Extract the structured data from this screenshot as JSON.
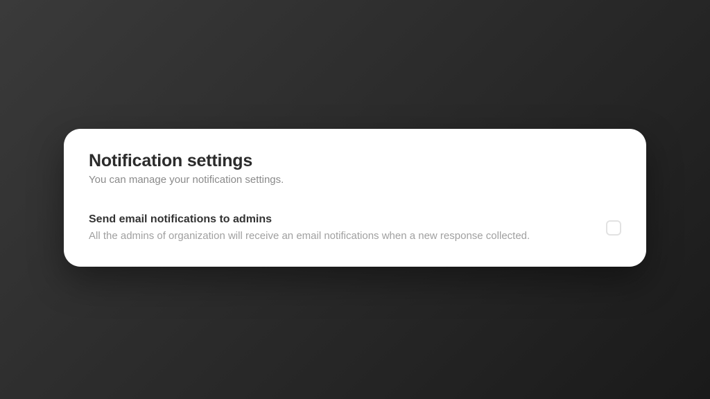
{
  "card": {
    "title": "Notification settings",
    "subtitle": "You can manage your notification settings."
  },
  "setting": {
    "title": "Send email notifications to admins",
    "description": "All the admins of organization will receive an email notifications when a new response collected.",
    "checked": false
  }
}
